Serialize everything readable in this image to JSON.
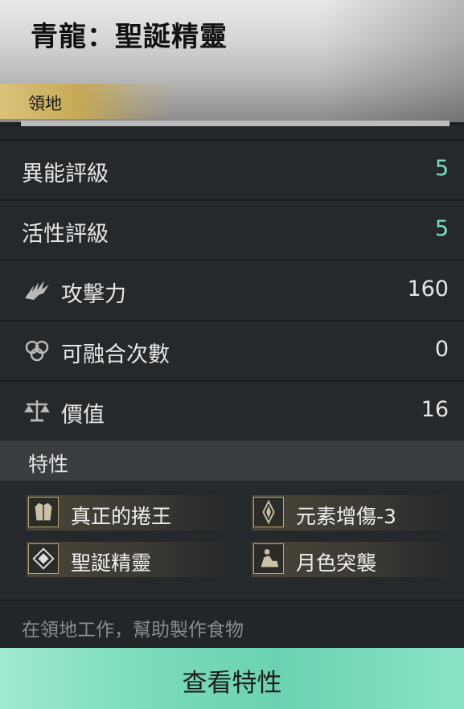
{
  "header": {
    "title": "青龍：聖誕精靈",
    "tag": "領地"
  },
  "stats": [
    {
      "label": "異能評級",
      "value": "5",
      "icon": ""
    },
    {
      "label": "活性評級",
      "value": "5",
      "icon": ""
    },
    {
      "label": "攻擊力",
      "value": "160",
      "icon": "claw-icon"
    },
    {
      "label": "可融合次數",
      "value": "0",
      "icon": "infinity-knot-icon"
    },
    {
      "label": "價值",
      "value": "16",
      "icon": "scales-icon"
    }
  ],
  "traits": {
    "heading": "特性",
    "items": [
      {
        "label": "真正的捲王",
        "icon": "coat-icon"
      },
      {
        "label": "元素增傷-3",
        "icon": "crystal-icon"
      },
      {
        "label": "聖誕精靈",
        "icon": "diamond-icon"
      },
      {
        "label": "月色突襲",
        "icon": "rider-icon"
      }
    ]
  },
  "description": "在領地工作，幫助製作食物",
  "button": {
    "label": "查看特性"
  },
  "colors": {
    "accent_teal": "#78e2c0",
    "tag_gold": "#c6a956",
    "button_green": "#7cdcbd"
  }
}
